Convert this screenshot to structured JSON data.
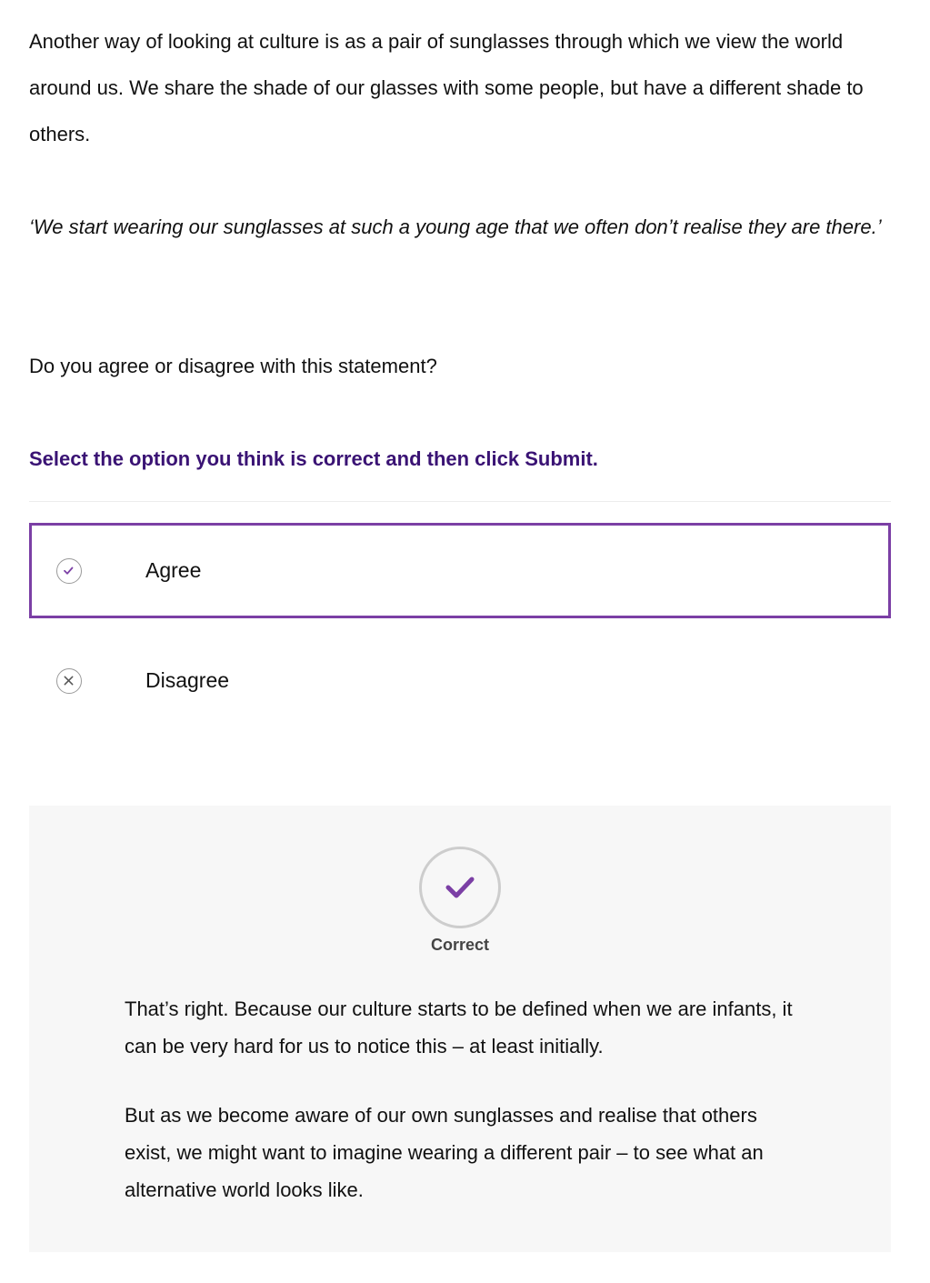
{
  "intro_text": "Another way of looking at culture is as a pair of sunglasses through which we view the world around us. We share the shade of our glasses with some people, but have a different shade to others.",
  "quote_text": "‘We start wearing our sunglasses at such a young age that we often don’t realise they are there.’",
  "question_text": "Do you agree or disagree with this statement?",
  "instruction_text": "Select the option you think is correct and then click Submit.",
  "options": [
    {
      "label": "Agree",
      "icon": "check-icon",
      "selected": true
    },
    {
      "label": "Disagree",
      "icon": "close-icon",
      "selected": false
    }
  ],
  "feedback": {
    "status_label": "Correct",
    "status_icon": "check-icon",
    "paragraphs": [
      "That’s right. Because our culture starts to be defined when we are infants, it can be very hard for us to notice this – at least initially.",
      "But as we become aware of our own sunglasses and realise that others exist, we might want to imagine wearing a different pair – to see what an alternative world looks like."
    ]
  },
  "colors": {
    "accent_purple": "#7b3fa5",
    "instruction_purple": "#3a1374",
    "feedback_bg": "#f7f7f7"
  }
}
